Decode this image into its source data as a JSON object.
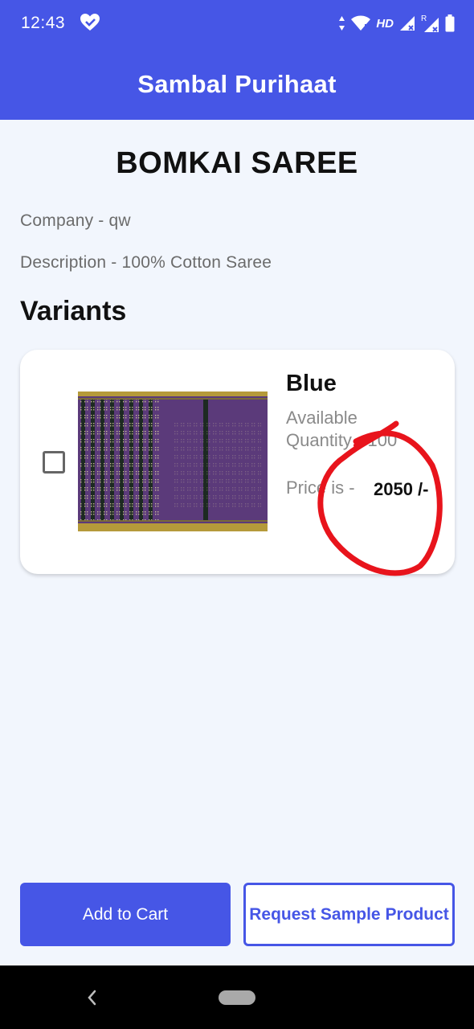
{
  "status_bar": {
    "time": "12:43",
    "network": "HD",
    "icons": [
      "heart-check-icon",
      "data-arrows-icon",
      "wifi-icon",
      "signal-icon",
      "signal-roaming-icon",
      "battery-icon"
    ]
  },
  "app_bar": {
    "title": "Sambal Purihaat"
  },
  "product": {
    "title": "BOMKAI SAREE",
    "company": "Company - qw",
    "description": "Description - 100% Cotton Saree"
  },
  "variants_heading": "Variants",
  "variants": [
    {
      "color": "Blue",
      "available_quantity": "Available Quantity - 100",
      "price_label": "Price is -",
      "price_value": "2050 /-",
      "checked": false,
      "image": "purple-saree-image"
    }
  ],
  "buttons": {
    "add_to_cart": "Add to Cart",
    "request_sample": "Request Sample Product"
  },
  "colors": {
    "primary": "#4656e6",
    "background": "#f2f6fd",
    "annotation": "#e8141c"
  }
}
